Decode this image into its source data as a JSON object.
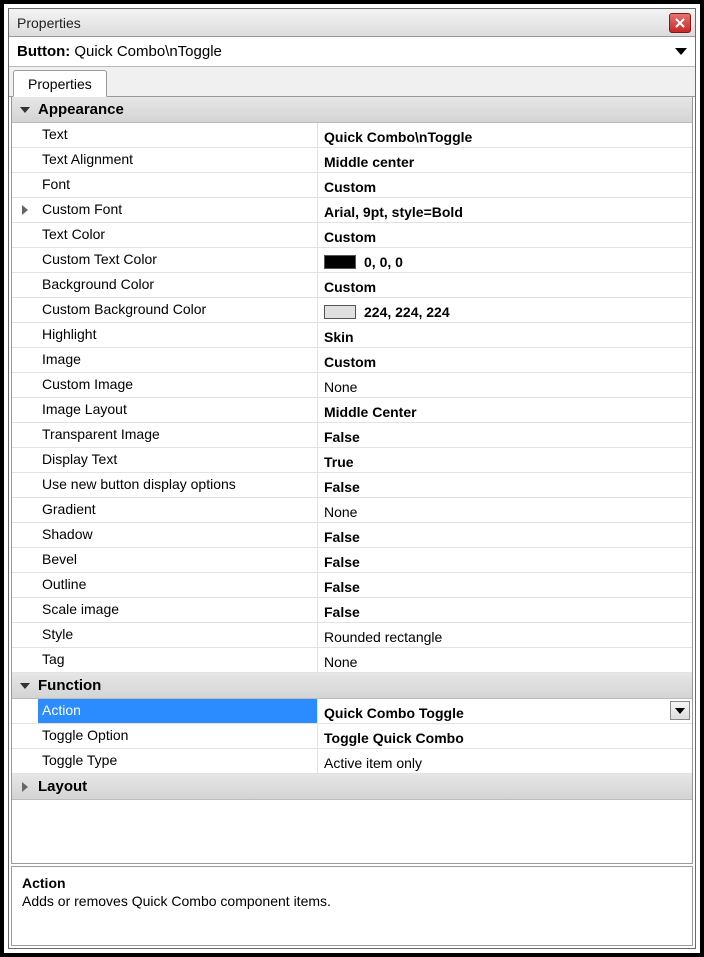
{
  "window": {
    "title": "Properties"
  },
  "header": {
    "label": "Button:",
    "value": "Quick Combo\\nToggle"
  },
  "tab": {
    "label": "Properties"
  },
  "categories": {
    "appearance": {
      "label": "Appearance",
      "expanded": true
    },
    "function": {
      "label": "Function",
      "expanded": true
    },
    "layout": {
      "label": "Layout",
      "expanded": false
    }
  },
  "props": {
    "text": {
      "label": "Text",
      "value": "Quick Combo\\nToggle",
      "bold": true
    },
    "textAlignment": {
      "label": "Text Alignment",
      "value": "Middle center",
      "bold": true
    },
    "font": {
      "label": "Font",
      "value": "Custom",
      "bold": true
    },
    "customFont": {
      "label": "Custom Font",
      "value": "Arial, 9pt, style=Bold",
      "bold": true,
      "expandable": true
    },
    "textColor": {
      "label": "Text Color",
      "value": "Custom",
      "bold": true
    },
    "customTextColor": {
      "label": "Custom Text Color",
      "value": "0, 0, 0",
      "bold": true,
      "swatch": "#000000"
    },
    "backgroundColor": {
      "label": "Background Color",
      "value": "Custom",
      "bold": true
    },
    "customBackgroundColor": {
      "label": "Custom Background Color",
      "value": "224, 224, 224",
      "bold": true,
      "swatch": "#e0e0e0"
    },
    "highlight": {
      "label": "Highlight",
      "value": "Skin",
      "bold": true
    },
    "image": {
      "label": "Image",
      "value": "Custom",
      "bold": true
    },
    "customImage": {
      "label": "Custom Image",
      "value": "None",
      "bold": false
    },
    "imageLayout": {
      "label": "Image Layout",
      "value": "Middle Center",
      "bold": true
    },
    "transparentImage": {
      "label": "Transparent Image",
      "value": "False",
      "bold": true
    },
    "displayText": {
      "label": "Display Text",
      "value": "True",
      "bold": true
    },
    "useNewButtonDisplay": {
      "label": "Use new button display options",
      "value": "False",
      "bold": true
    },
    "gradient": {
      "label": "Gradient",
      "value": "None",
      "bold": false
    },
    "shadow": {
      "label": "Shadow",
      "value": "False",
      "bold": true
    },
    "bevel": {
      "label": "Bevel",
      "value": "False",
      "bold": true
    },
    "outline": {
      "label": "Outline",
      "value": "False",
      "bold": true
    },
    "scaleImage": {
      "label": "Scale image",
      "value": "False",
      "bold": true
    },
    "style": {
      "label": "Style",
      "value": "Rounded rectangle",
      "bold": false
    },
    "tag": {
      "label": "Tag",
      "value": "None",
      "bold": false
    },
    "action": {
      "label": "Action",
      "value": "Quick Combo Toggle",
      "bold": true,
      "selected": true,
      "dropdown": true
    },
    "toggleOption": {
      "label": "Toggle Option",
      "value": "Toggle Quick Combo",
      "bold": true
    },
    "toggleType": {
      "label": "Toggle Type",
      "value": "Active item only",
      "bold": false
    }
  },
  "description": {
    "title": "Action",
    "body": "Adds or removes Quick Combo component items."
  }
}
